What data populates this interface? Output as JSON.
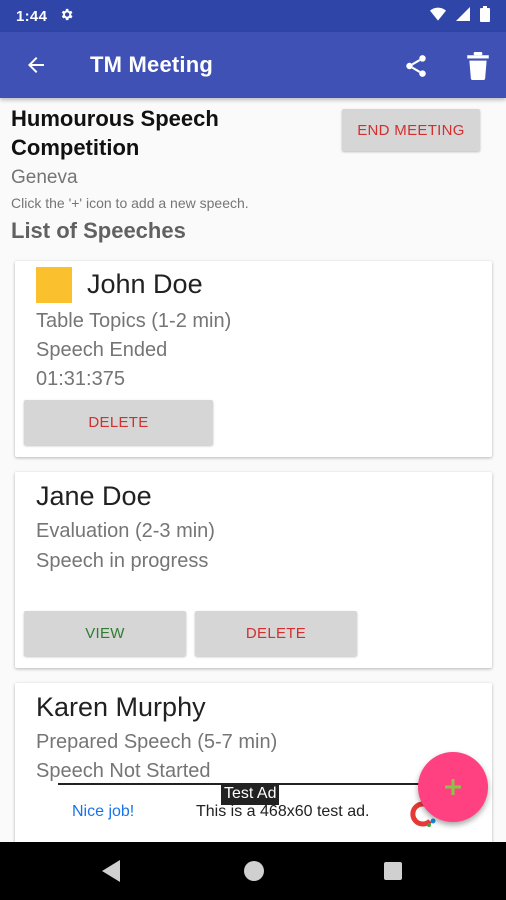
{
  "status_bar": {
    "time": "1:44"
  },
  "app_bar": {
    "title": "TM Meeting"
  },
  "meeting": {
    "title": "Humourous Speech Competition",
    "location": "Geneva",
    "hint": "Click the '+' icon to add a new speech.",
    "end_button_label": "END MEETING",
    "list_heading": "List of Speeches"
  },
  "speeches": [
    {
      "speaker": "John Doe",
      "type": "Table Topics (1-2 min)",
      "status": "Speech Ended",
      "time": "01:31:375",
      "color": "#fbc02d",
      "delete_label": "DELETE"
    },
    {
      "speaker": "Jane Doe",
      "type": "Evaluation (2-3 min)",
      "status": "Speech in progress",
      "view_label": "VIEW",
      "delete_label": "DELETE"
    },
    {
      "speaker": "Karen Murphy",
      "type": "Prepared Speech (5-7 min)",
      "status": "Speech Not Started"
    }
  ],
  "ad": {
    "tag": "Test Ad",
    "nice_job": "Nice job!",
    "text": "This is a 468x60 test ad."
  },
  "colors": {
    "primary": "#3f51b5",
    "primary_dark": "#2f46a8",
    "accent": "#ff4081",
    "delete": "#d32f2f",
    "view": "#2e7d32"
  }
}
